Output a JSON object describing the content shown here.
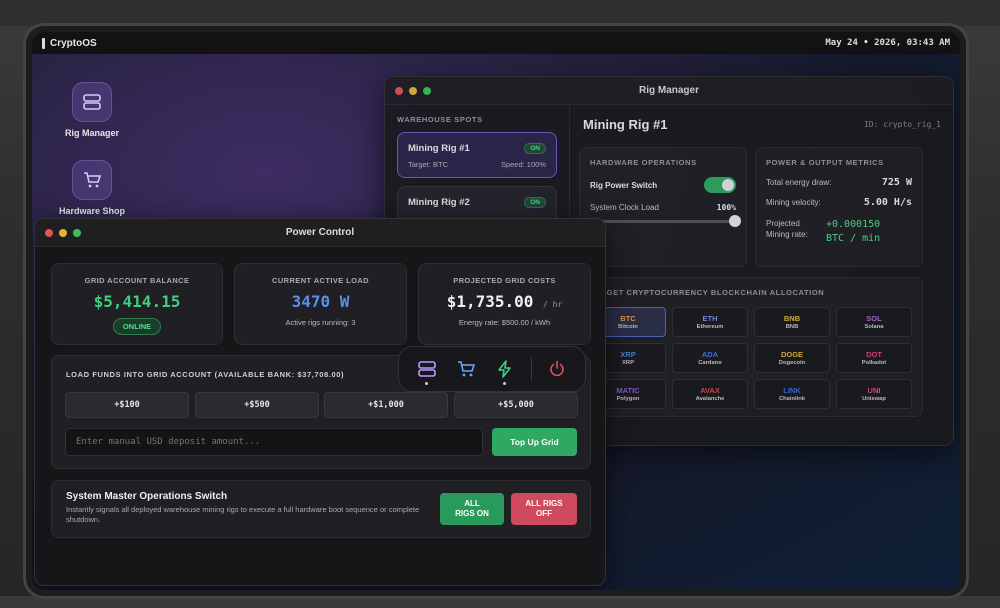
{
  "topbar": {
    "os_name": "CryptoOS",
    "datetime": "May 24 • 2026, 03:43 AM"
  },
  "desktop": {
    "icons": [
      {
        "label": "Rig Manager",
        "icon": "server-icon"
      },
      {
        "label": "Hardware Shop",
        "icon": "cart-icon"
      }
    ]
  },
  "rig_manager": {
    "title": "Rig Manager",
    "spots_label": "WAREHOUSE SPOTS",
    "rigs": [
      {
        "name": "Mining Rig #1",
        "status": "ON",
        "target": "Target: BTC",
        "speed": "Speed: 100%"
      },
      {
        "name": "Mining Rig #2",
        "status": "ON"
      }
    ],
    "selected_name": "Mining Rig #1",
    "selected_id": "ID: crypto_rig_1",
    "hardware": {
      "label": "HARDWARE OPERATIONS",
      "power_switch_label": "Rig Power Switch",
      "power_on": true,
      "clock_label": "System Clock Load",
      "clock_value": "100%",
      "clock_level": 1.0
    },
    "metrics": {
      "label": "POWER & OUTPUT METRICS",
      "energy_label": "Total energy draw:",
      "energy_value": "725 W",
      "velocity_label": "Mining velocity:",
      "velocity_value": "5.00 H/s",
      "projected_label_1": "Projected",
      "projected_label_2": "Mining rate:",
      "projected_value_1": "+0.000150",
      "projected_value_2": "BTC / min"
    },
    "allocation": {
      "label": "TARGET CRYPTOCURRENCY BLOCKCHAIN ALLOCATION",
      "coins": [
        {
          "sym": "BTC",
          "name": "Bitcoin",
          "color": "#f2a33a",
          "selected": true
        },
        {
          "sym": "ETH",
          "name": "Ethereum",
          "color": "#7f8fe8"
        },
        {
          "sym": "BNB",
          "name": "BNB",
          "color": "#e6b93a"
        },
        {
          "sym": "SOL",
          "name": "Solana",
          "color": "#b36be8"
        },
        {
          "sym": "XRP",
          "name": "XRP",
          "color": "#4a8ce0"
        },
        {
          "sym": "ADA",
          "name": "Cardano",
          "color": "#3f7be6"
        },
        {
          "sym": "DOGE",
          "name": "Dogecoin",
          "color": "#e0b83c"
        },
        {
          "sym": "DOT",
          "name": "Polkadot",
          "color": "#e2447e"
        },
        {
          "sym": "MATIC",
          "name": "Polygon",
          "color": "#8d5ee8"
        },
        {
          "sym": "AVAX",
          "name": "Avalanche",
          "color": "#e04848"
        },
        {
          "sym": "LINK",
          "name": "Chainlink",
          "color": "#3d6ee0"
        },
        {
          "sym": "UNI",
          "name": "Uniswap",
          "color": "#e84a9a"
        }
      ]
    }
  },
  "power_control": {
    "title": "Power Control",
    "balance": {
      "label": "GRID ACCOUNT BALANCE",
      "value": "$5,414.15",
      "status": "ONLINE"
    },
    "load": {
      "label": "CURRENT ACTIVE LOAD",
      "value": "3470 W",
      "sub": "Active rigs running: 3"
    },
    "costs": {
      "label": "PROJECTED GRID COSTS",
      "value": "$1,735.00",
      "unit": "/ hr",
      "sub": "Energy rate: $500.00 / kWh"
    },
    "funds": {
      "label": "LOAD FUNDS INTO GRID ACCOUNT (AVAILABLE BANK: $37,708.00)",
      "quick": [
        "+$100",
        "+$500",
        "+$1,000",
        "+$5,000"
      ],
      "placeholder": "Enter manual USD deposit amount...",
      "topup_label": "Top Up Grid"
    },
    "master": {
      "title": "System Master Operations Switch",
      "desc": "Instantly signals all deployed warehouse mining rigs to execute a full hardware boot sequence or complete shutdown.",
      "on_label": "ALL RIGS ON",
      "off_label": "ALL RIGS OFF"
    }
  },
  "dock": {
    "items": [
      "server-icon",
      "cart-icon",
      "lightning-icon",
      "power-icon"
    ]
  },
  "colors": {
    "accent_green": "#2fa863",
    "accent_red": "#d24a5a",
    "balance_green": "#3ecf7f",
    "load_blue": "#5b8ef0",
    "mono_green": "#4fe08c"
  }
}
